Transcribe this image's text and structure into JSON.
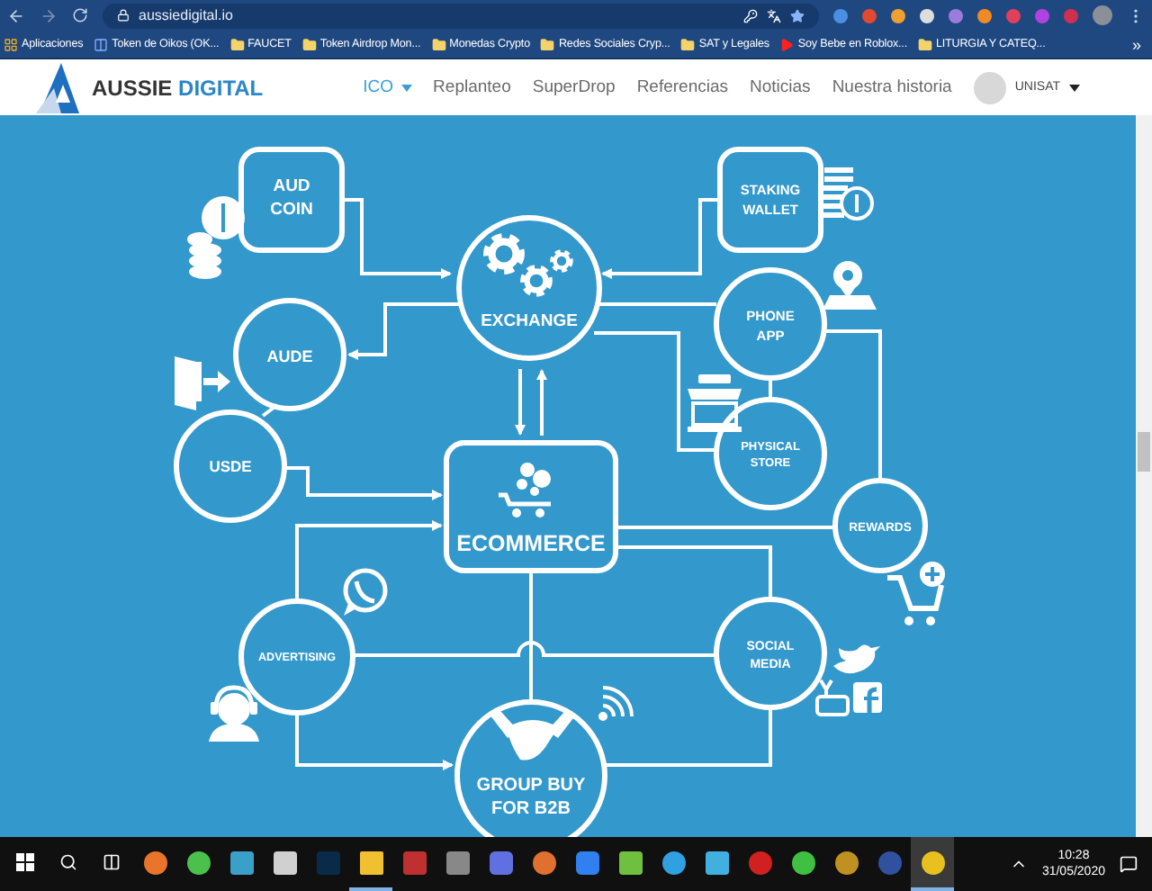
{
  "browser": {
    "url": "aussiedigital.io",
    "bookmarks": [
      {
        "label": "Aplicaciones",
        "kind": "apps"
      },
      {
        "label": "Token de Oikos (OK...",
        "kind": "page"
      },
      {
        "label": "FAUCET",
        "kind": "folder"
      },
      {
        "label": "Token Airdrop Mon...",
        "kind": "folder"
      },
      {
        "label": "Monedas Crypto",
        "kind": "folder"
      },
      {
        "label": "Redes Sociales Cryp...",
        "kind": "folder"
      },
      {
        "label": "SAT y Legales",
        "kind": "folder"
      },
      {
        "label": "Soy Bebe en Roblox...",
        "kind": "video"
      },
      {
        "label": "LITURGIA Y CATEQ...",
        "kind": "folder"
      }
    ],
    "more": "»"
  },
  "site": {
    "logo": {
      "name": "AUSSIE",
      "accent": "DIGITAL"
    },
    "nav": [
      {
        "label": "ICO",
        "selected": true,
        "dropdown": true
      },
      {
        "label": "Replanteo",
        "selected": false,
        "dropdown": false
      },
      {
        "label": "SuperDrop",
        "selected": false,
        "dropdown": false
      },
      {
        "label": "Referencias",
        "selected": false,
        "dropdown": false
      },
      {
        "label": "Noticias",
        "selected": false,
        "dropdown": false
      },
      {
        "label": "Nuestra historia",
        "selected": false,
        "dropdown": false
      }
    ],
    "user": "UNISAT"
  },
  "diagram": {
    "nodes": [
      {
        "kind": "box",
        "lines": [
          "AUD",
          "COIN"
        ]
      },
      {
        "kind": "circle",
        "lines": [
          "EXCHANGE"
        ]
      },
      {
        "kind": "box",
        "lines": [
          "STAKING",
          "WALLET"
        ]
      },
      {
        "kind": "circle",
        "lines": [
          "AUDE"
        ]
      },
      {
        "kind": "circle",
        "lines": [
          "PHONE",
          "APP"
        ]
      },
      {
        "kind": "circle",
        "lines": [
          "USDE"
        ]
      },
      {
        "kind": "circle",
        "lines": [
          "PHYSICAL",
          "STORE"
        ]
      },
      {
        "kind": "box",
        "lines": [
          "ECOMMERCE"
        ]
      },
      {
        "kind": "circle",
        "lines": [
          "REWARDS"
        ]
      },
      {
        "kind": "circle",
        "lines": [
          "ADVERTISING"
        ]
      },
      {
        "kind": "circle",
        "lines": [
          "SOCIAL",
          "MEDIA"
        ]
      },
      {
        "kind": "circle",
        "lines": [
          "GROUP BUY",
          "FOR B2B"
        ]
      }
    ]
  },
  "taskbar": {
    "apps": [
      {
        "running": false,
        "selected": false
      },
      {
        "running": false,
        "selected": false
      },
      {
        "running": false,
        "selected": false
      },
      {
        "running": false,
        "selected": false
      },
      {
        "running": false,
        "selected": false
      },
      {
        "running": true,
        "selected": false
      },
      {
        "running": false,
        "selected": false
      },
      {
        "running": false,
        "selected": false
      },
      {
        "running": false,
        "selected": false
      },
      {
        "running": false,
        "selected": false
      },
      {
        "running": false,
        "selected": false
      },
      {
        "running": false,
        "selected": false
      },
      {
        "running": false,
        "selected": false
      },
      {
        "running": false,
        "selected": false
      },
      {
        "running": false,
        "selected": false
      },
      {
        "running": false,
        "selected": false
      },
      {
        "running": false,
        "selected": false
      },
      {
        "running": false,
        "selected": false
      },
      {
        "running": true,
        "selected": true
      }
    ],
    "time": "10:28",
    "date": "31/05/2020"
  }
}
